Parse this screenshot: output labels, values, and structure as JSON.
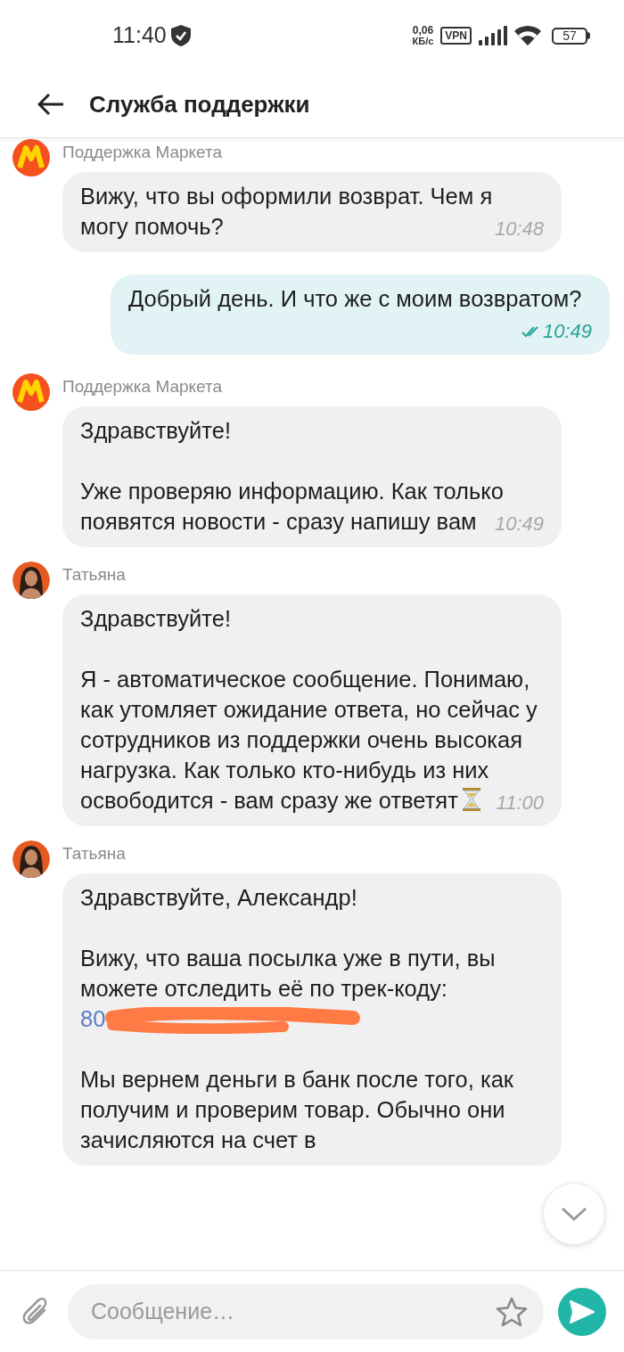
{
  "status_bar": {
    "time": "11:40",
    "speed_value": "0,06",
    "speed_unit": "КБ/с",
    "vpn": "VPN",
    "battery": "57"
  },
  "header": {
    "title": "Служба поддержки"
  },
  "messages": [
    {
      "kind": "incoming",
      "avatar": {
        "kind": "market"
      },
      "sender": "Поддержка Маркета",
      "paragraphs": [
        {
          "text": "Вижу, что вы оформили возврат. Чем я могу помочь?"
        }
      ],
      "time": "10:48"
    },
    {
      "kind": "outgoing",
      "read": true,
      "paragraphs": [
        {
          "text": "Добрый день. И что же с моим возвратом?"
        }
      ],
      "time": "10:49"
    },
    {
      "kind": "incoming",
      "avatar": {
        "kind": "market"
      },
      "sender": "Поддержка Маркета",
      "paragraphs": [
        {
          "text": "Здравствуйте!"
        },
        {
          "text": "Уже проверяю информацию. Как только появятся новости - сразу напишу вам"
        }
      ],
      "time": "10:49"
    },
    {
      "kind": "incoming",
      "avatar": {
        "kind": "person"
      },
      "sender": "Татьяна",
      "end_icon": {
        "kind": "hourglass"
      },
      "paragraphs": [
        {
          "text": "Здравствуйте!"
        },
        {
          "text": "Я - автоматическое сообщение. Понимаю, как утомляет ожидание ответа, но сейчас у сотрудников из поддержки очень высокая нагрузка. Как только кто-нибудь из них освободится - вам сразу же ответят"
        }
      ],
      "time": "11:00"
    },
    {
      "kind": "incoming",
      "avatar": {
        "kind": "person"
      },
      "sender": "Татьяна",
      "paragraphs": [
        {
          "text": "Здравствуйте, Александр!"
        },
        {
          "text": "Вижу, что ваша посылка уже в пути, вы можете  отследить её по трек-коду:",
          "link": "80",
          "redacted": true
        },
        {
          "text": "Мы вернем деньги в банк после того, как получим и проверим товар. Обычно они зачисляются на счет в"
        }
      ]
    }
  ],
  "composer": {
    "placeholder": "Сообщение…"
  }
}
